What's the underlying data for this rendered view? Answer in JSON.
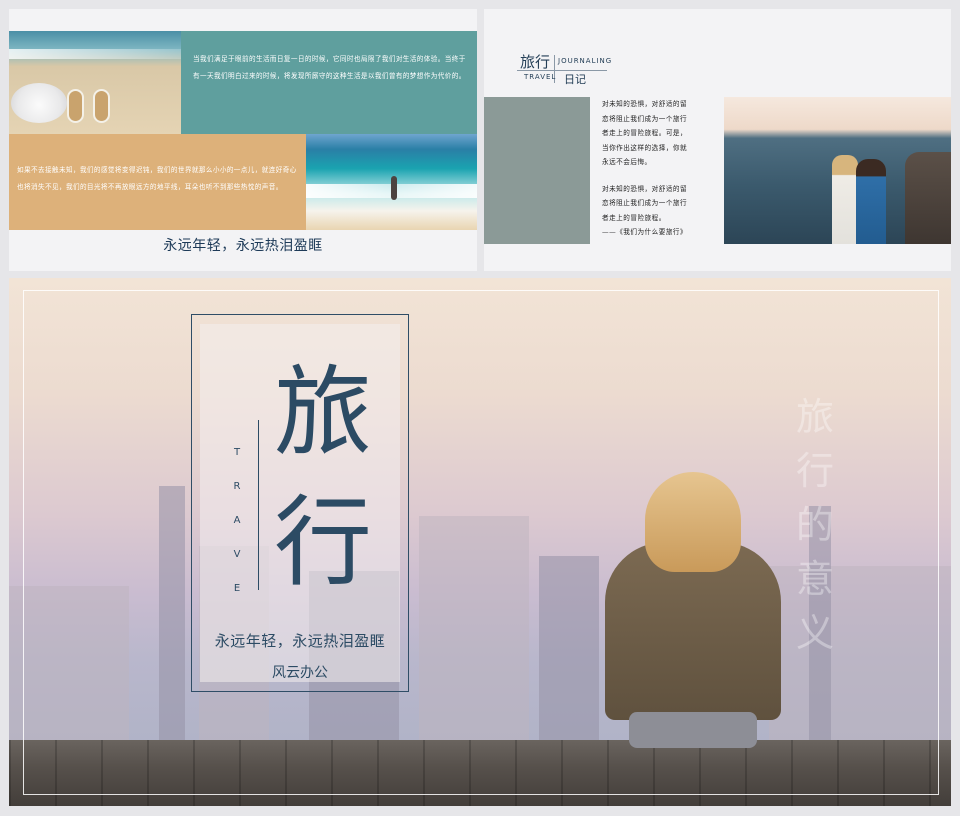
{
  "slide1": {
    "teal_text": "当我们满足于眼前的生活而日复一日的时候，它同时也局限了我们对生活的体验。当终于有一天我们明白过来的时候，将发现所厮守的这种生活是以我们曾有的梦想作为代价的。",
    "tan_text": "如果不去接触未知，我们的感觉将变得迟钝，我们的世界就那么小小的一点儿，就连好奇心也将消失不见，我们的目光将不再放眼远方的地平线，耳朵也听不到那些热忱的声音。",
    "caption": "永远年轻，永远热泪盈眶"
  },
  "slide2": {
    "logo": {
      "cn": "旅行",
      "en1": "JOURNALING",
      "en2": "TRAVEL",
      "sub": "日记"
    },
    "paragraph1": [
      "对未知的恐惧，对舒适的留",
      "恋将阻止我们成为一个旅行",
      "者走上的冒险旅程。可是，",
      "当你作出这样的选择，你就",
      "永远不会后悔。"
    ],
    "paragraph2": [
      "对未知的恐惧，对舒适的留",
      "恋将阻止我们成为一个旅行",
      "者走上的冒险旅程。"
    ],
    "quote": "——《我们为什么要旅行》"
  },
  "slide3": {
    "char1": "旅",
    "char2": "行",
    "vertical_en": [
      "T",
      "R",
      "A",
      "V",
      "E"
    ],
    "tagline": "永远年轻，永远热泪盈眶",
    "brand": "风云办公",
    "ghost_chars": [
      "旅",
      "行",
      "的",
      "意",
      "义"
    ]
  }
}
